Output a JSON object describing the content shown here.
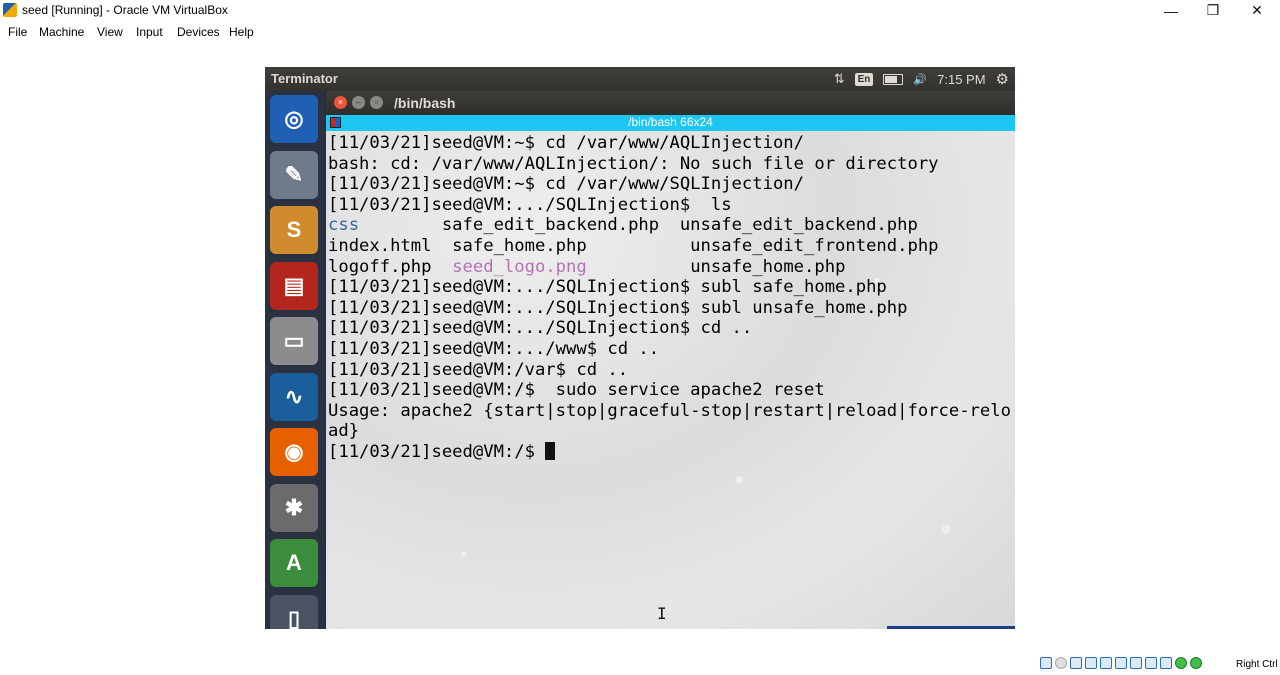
{
  "host": {
    "title": "seed [Running] - Oracle VM VirtualBox",
    "window_buttons": {
      "minimize": "—",
      "restore": "❐",
      "close": "✕"
    },
    "menu": [
      "File",
      "Machine",
      "View",
      "Input",
      "Devices",
      "Help"
    ],
    "status_host_key": "Right Ctrl"
  },
  "guest": {
    "app_name": "Terminator",
    "tray": {
      "network_icon": "⇅",
      "lang": "En",
      "volume_icon": "🔊",
      "clock": "7:15 PM",
      "gear_icon": "⚙"
    },
    "launcher": [
      {
        "name": "ubuntu-dash",
        "glyph": "◎",
        "bg": "#1f5fb4"
      },
      {
        "name": "text-editor",
        "glyph": "✎",
        "bg": "#6f7b8a"
      },
      {
        "name": "sublime-text",
        "glyph": "S",
        "bg": "#d08b2e"
      },
      {
        "name": "terminal-app",
        "glyph": "▤",
        "bg": "#b3261e"
      },
      {
        "name": "file-manager",
        "glyph": "▭",
        "bg": "#8c8c8c"
      },
      {
        "name": "wireshark",
        "glyph": "∿",
        "bg": "#1a5f9c"
      },
      {
        "name": "firefox",
        "glyph": "◉",
        "bg": "#e66000"
      },
      {
        "name": "system-settings",
        "glyph": "✱",
        "bg": "#6b6b6b"
      },
      {
        "name": "software-updater",
        "glyph": "A",
        "bg": "#3b8d3b"
      },
      {
        "name": "trash",
        "glyph": "▯",
        "bg": "#4a5263"
      }
    ],
    "terminal": {
      "window_title": "/bin/bash",
      "tab_title": "/bin/bash 66x24",
      "lines": [
        [
          {
            "t": "[11/03/21]seed@VM:~$ cd /var/www/AQLInjection/"
          }
        ],
        [
          {
            "t": "bash: cd: /var/www/AQLInjection/: No such file or directory"
          }
        ],
        [
          {
            "t": "[11/03/21]seed@VM:~$ cd /var/www/SQLInjection/"
          }
        ],
        [
          {
            "t": "[11/03/21]seed@VM:.../SQLInjection$  ls"
          }
        ],
        [
          {
            "t": "css",
            "c": "c-dir"
          },
          {
            "t": "        safe_edit_backend.php  unsafe_edit_backend.php"
          }
        ],
        [
          {
            "t": "index.html  safe_home.php          unsafe_edit_frontend.php"
          }
        ],
        [
          {
            "t": "logoff.php  "
          },
          {
            "t": "seed_logo.png",
            "c": "c-img"
          },
          {
            "t": "          unsafe_home.php"
          }
        ],
        [
          {
            "t": "[11/03/21]seed@VM:.../SQLInjection$ subl safe_home.php"
          }
        ],
        [
          {
            "t": "[11/03/21]seed@VM:.../SQLInjection$ subl unsafe_home.php"
          }
        ],
        [
          {
            "t": "[11/03/21]seed@VM:.../SQLInjection$ cd .."
          }
        ],
        [
          {
            "t": "[11/03/21]seed@VM:.../www$ cd .."
          }
        ],
        [
          {
            "t": "[11/03/21]seed@VM:/var$ cd .."
          }
        ],
        [
          {
            "t": "[11/03/21]seed@VM:/$  sudo service apache2 reset"
          }
        ],
        [
          {
            "t": "Usage: apache2 {start|stop|graceful-stop|restart|reload|force-relo"
          }
        ],
        [
          {
            "t": "ad}"
          }
        ],
        [
          {
            "t": "[11/03/21]seed@VM:/$ "
          },
          {
            "cursor": true
          }
        ]
      ]
    }
  }
}
